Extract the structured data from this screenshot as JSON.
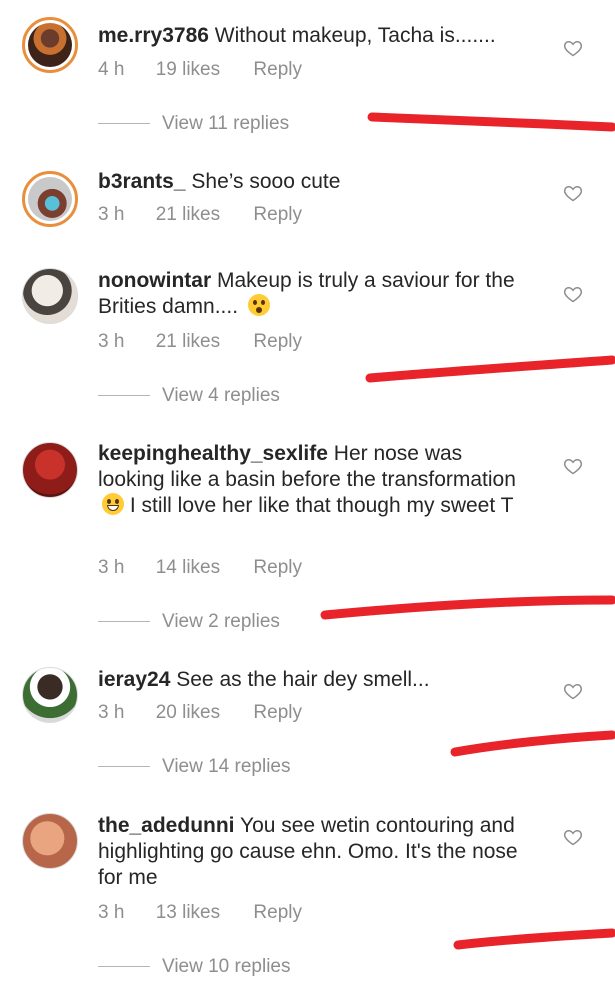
{
  "comments": [
    {
      "username": "me.rry3786",
      "text": "Without makeup, Tacha is.......",
      "time": "4 h",
      "likes": "19 likes",
      "reply": "Reply",
      "view_replies": "View 11 replies"
    },
    {
      "username": "b3rants_",
      "text": "She’s sooo cute",
      "time": "3 h",
      "likes": "21 likes",
      "reply": "Reply",
      "view_replies": ""
    },
    {
      "username": "nonowintar",
      "text": "Makeup is truly a saviour for the Brities damn....",
      "time": "3 h",
      "likes": "21 likes",
      "reply": "Reply",
      "view_replies": "View 4 replies"
    },
    {
      "username": "keepinghealthy_sexlife",
      "text": "Her nose was looking like a basin before the transformation",
      "text_after_emoji": "I still love her like that though my sweet T",
      "time": "3 h",
      "likes": "14 likes",
      "reply": "Reply",
      "view_replies": "View 2 replies"
    },
    {
      "username": "ieray24",
      "text": "See as the hair dey smell...",
      "time": "3 h",
      "likes": "20 likes",
      "reply": "Reply",
      "view_replies": "View 14 replies"
    },
    {
      "username": "the_adedunni",
      "text": "You see wetin contouring and highlighting go cause ehn. Omo. It's the nose for me",
      "time": "3 h",
      "likes": "13 likes",
      "reply": "Reply",
      "view_replies": "View 10 replies"
    }
  ],
  "colors": {
    "text": "#262626",
    "meta": "#8e8e8e",
    "story_ring": "#e98f3b",
    "annotation_red": "#e8242a"
  },
  "icons": [
    "heart-icon",
    "surprised-emoji-icon",
    "grinning-sweat-emoji-icon"
  ]
}
